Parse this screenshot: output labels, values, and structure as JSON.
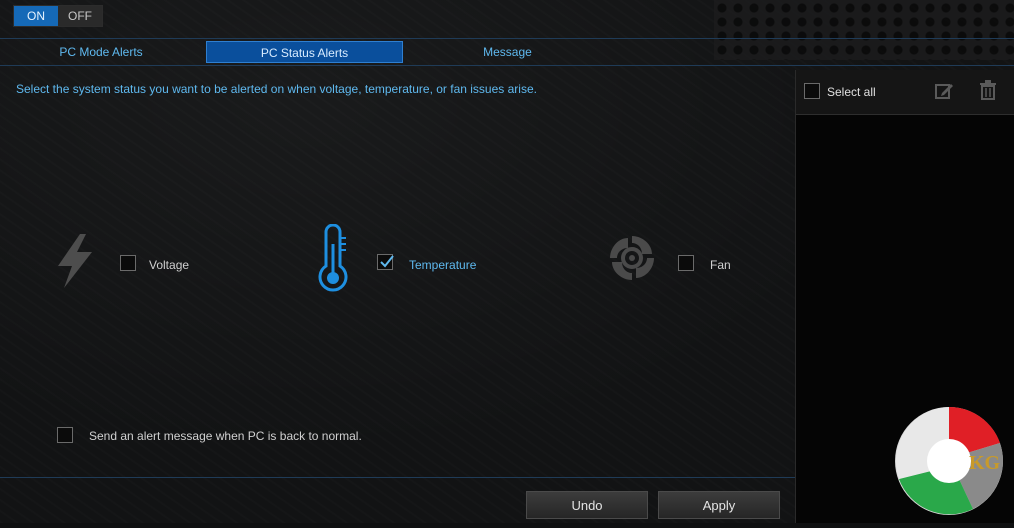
{
  "power_toggle": {
    "on_label": "ON",
    "off_label": "OFF",
    "selected": "ON"
  },
  "tabs": [
    {
      "label": "PC Mode Alerts",
      "active": false
    },
    {
      "label": "PC Status Alerts",
      "active": true
    },
    {
      "label": "Message",
      "active": false
    }
  ],
  "description": "Select the system status you want to be alerted on when voltage, temperature, or fan issues arise.",
  "alerts": {
    "voltage": {
      "label": "Voltage",
      "icon": "lightning-bolt-icon",
      "checked": false
    },
    "temperature": {
      "label": "Temperature",
      "icon": "thermometer-icon",
      "checked": true
    },
    "fan": {
      "label": "Fan",
      "icon": "fan-icon",
      "checked": false
    }
  },
  "back_to_normal": {
    "label": "Send an alert message when PC is back to normal.",
    "checked": false
  },
  "right_panel": {
    "select_all_label": "Select all",
    "select_all_checked": false,
    "edit_icon": "edit-icon",
    "delete_icon": "trash-icon"
  },
  "buttons": {
    "undo": "Undo",
    "apply": "Apply"
  },
  "watermark": {
    "text": "KG"
  },
  "colors": {
    "accent": "#5fb9ef",
    "active_tab": "#0a4f9c",
    "toggle_on": "#1569b7"
  }
}
